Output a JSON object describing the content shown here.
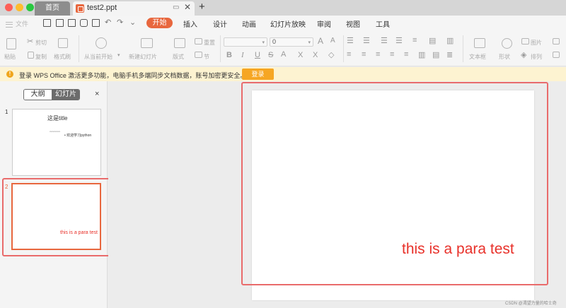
{
  "titlebar": {
    "home_tab": "首页",
    "doc_tab": "test2.ppt",
    "new_tab": "+"
  },
  "menubar": {
    "file_label": "文件",
    "items": [
      "开始",
      "插入",
      "设计",
      "动画",
      "幻灯片放映",
      "审阅",
      "视图",
      "工具"
    ],
    "active_index": 0
  },
  "ribbon": {
    "paste": "粘贴",
    "cut": "剪切",
    "copy": "复制",
    "format_painter": "格式刷",
    "play_from_current": "从当前开始",
    "new_slide": "新建幻灯片",
    "layout": "版式",
    "reset": "重置",
    "section": "节",
    "font_size": "0",
    "textbox": "文本框",
    "shapes": "形状",
    "picture": "图片",
    "arrange": "排列"
  },
  "notice": {
    "text": "登录 WPS Office 激活更多功能，电脑手机多端同步文档数据，账号加密更安全。",
    "login_button": "登录"
  },
  "pane": {
    "tab_outline": "大纲",
    "tab_slides": "幻灯片",
    "close": "×",
    "slides": [
      {
        "number": "1",
        "title": "这是title",
        "bullet_small": "xxxxxxxxxx",
        "bullet": "欢迎学习python"
      },
      {
        "number": "2",
        "text": "this is a para test"
      }
    ]
  },
  "editor": {
    "slide_text": "this is a para test"
  },
  "watermark": "CSDN @渴望力量的哈士奇",
  "colors": {
    "accent": "#e8673e",
    "selection": "#e96b6b",
    "slide_text": "#e8312a",
    "notice_bg": "#fdf3d1",
    "login_btn": "#f6a623"
  }
}
